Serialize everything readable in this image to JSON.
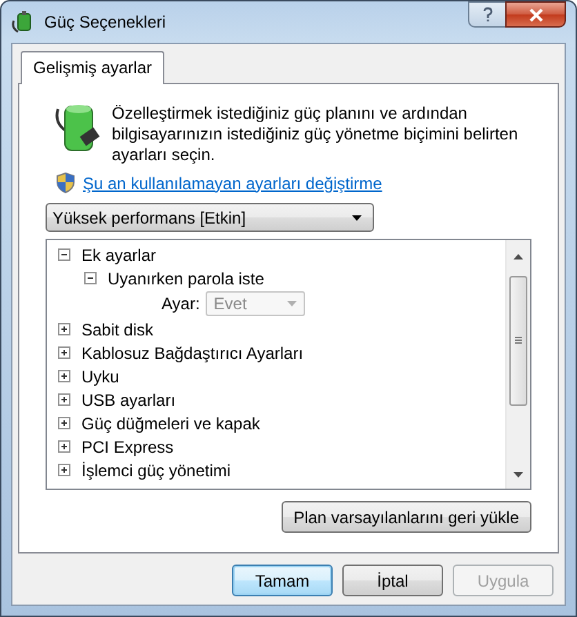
{
  "window": {
    "title": "Güç Seçenekleri"
  },
  "tabs": [
    {
      "label": "Gelişmiş ayarlar",
      "selected": true
    }
  ],
  "description": "Özelleştirmek istediğiniz güç planını ve ardından bilgisayarınızın istediğiniz güç yönetme biçimini belirten ayarları seçin.",
  "admin_link": "Şu an kullanılamayan ayarları değiştirme",
  "plan_dropdown": {
    "value": "Yüksek performans [Etkin]"
  },
  "tree": [
    {
      "label": "Ek ayarlar",
      "expanded": true,
      "children": [
        {
          "label": "Uyanırken parola iste",
          "expanded": true,
          "setting": {
            "label": "Ayar:",
            "value": "Evet",
            "disabled": true
          }
        }
      ]
    },
    {
      "label": "Sabit disk",
      "expanded": false
    },
    {
      "label": "Kablosuz Bağdaştırıcı Ayarları",
      "expanded": false
    },
    {
      "label": "Uyku",
      "expanded": false
    },
    {
      "label": "USB ayarları",
      "expanded": false
    },
    {
      "label": "Güç düğmeleri ve kapak",
      "expanded": false
    },
    {
      "label": "PCI Express",
      "expanded": false
    },
    {
      "label": "İşlemci güç yönetimi",
      "expanded": false
    }
  ],
  "restore_button": "Plan varsayılanlarını geri yükle",
  "buttons": [
    {
      "label": "Tamam",
      "kind": "default",
      "disabled": false
    },
    {
      "label": "İptal",
      "kind": "normal",
      "disabled": false
    },
    {
      "label": "Uygula",
      "kind": "normal",
      "disabled": true
    }
  ]
}
